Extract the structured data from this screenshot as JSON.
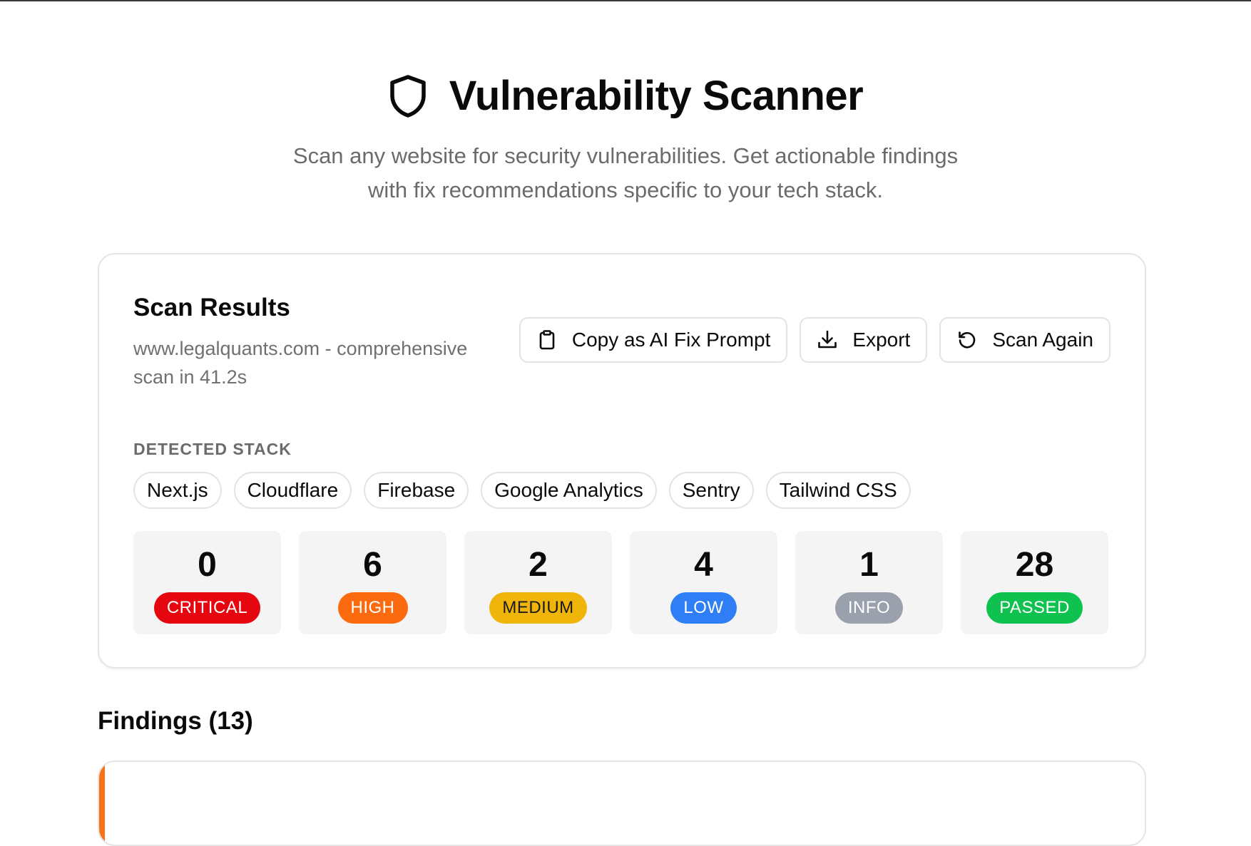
{
  "header": {
    "title": "Vulnerability Scanner",
    "icon": "shield-icon",
    "subtitle_line1": "Scan any website for security vulnerabilities. Get actionable findings",
    "subtitle_line2": "with fix recommendations specific to your tech stack."
  },
  "results": {
    "title": "Scan Results",
    "meta": "www.legalquants.com - comprehensive scan in 41.2s",
    "actions": [
      {
        "label": "Copy as AI Fix Prompt",
        "icon": "clipboard-icon"
      },
      {
        "label": "Export",
        "icon": "download-icon"
      },
      {
        "label": "Scan Again",
        "icon": "refresh-icon"
      }
    ],
    "stack_label": "DETECTED STACK",
    "stack": [
      "Next.js",
      "Cloudflare",
      "Firebase",
      "Google Analytics",
      "Sentry",
      "Tailwind CSS"
    ],
    "stats": [
      {
        "count": "0",
        "label": "CRITICAL",
        "color": "#e5060f",
        "text_color": "#ffffff"
      },
      {
        "count": "6",
        "label": "HIGH",
        "color": "#fb6a0f",
        "text_color": "#ffffff"
      },
      {
        "count": "2",
        "label": "MEDIUM",
        "color": "#f0b50a",
        "text_color": "#1a1a1a"
      },
      {
        "count": "4",
        "label": "LOW",
        "color": "#2f7ef5",
        "text_color": "#ffffff"
      },
      {
        "count": "1",
        "label": "INFO",
        "color": "#9aa1ad",
        "text_color": "#ffffff"
      },
      {
        "count": "28",
        "label": "PASSED",
        "color": "#0fc24f",
        "text_color": "#ffffff"
      }
    ]
  },
  "findings": {
    "title": "Findings (13)",
    "accent_color": "#f97316"
  }
}
